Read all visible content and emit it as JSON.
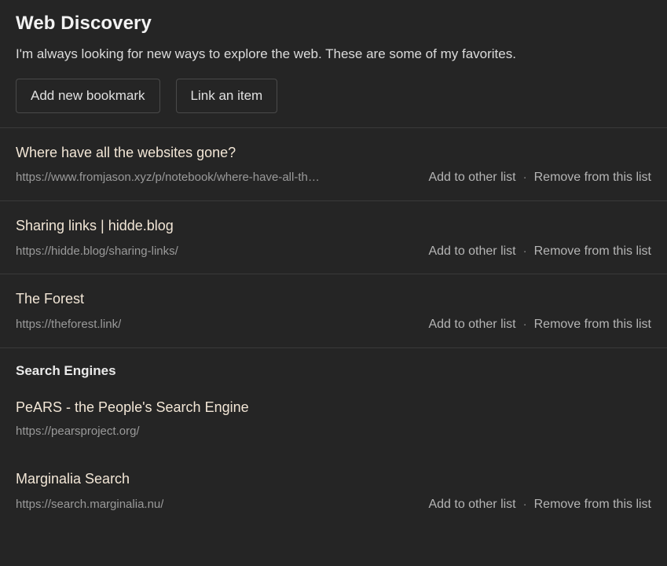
{
  "header": {
    "title": "Web Discovery",
    "description": "I'm always looking for new ways to explore the web. These are some of my favorites.",
    "buttons": {
      "add_bookmark": "Add new bookmark",
      "link_item": "Link an item"
    }
  },
  "actions": {
    "add_to_other_list": "Add to other list",
    "separator": "·",
    "remove_from_this_list": "Remove from this list"
  },
  "bookmarks": [
    {
      "title": "Where have all the websites gone?",
      "url": "https://www.fromjason.xyz/p/notebook/where-have-all-the-websites-gone/",
      "url_display": "https://www.fromjason.xyz/p/notebook/where-have-all-th…",
      "has_actions": true
    },
    {
      "title": "Sharing links | hidde.blog",
      "url": "https://hidde.blog/sharing-links/",
      "url_display": "https://hidde.blog/sharing-links/",
      "has_actions": true
    },
    {
      "title": "The Forest",
      "url": "https://theforest.link/",
      "url_display": "https://theforest.link/",
      "has_actions": true
    }
  ],
  "section": {
    "title": "Search Engines",
    "items": [
      {
        "title": "PeARS - the People's Search Engine",
        "url": "https://pearsproject.org/",
        "url_display": "https://pearsproject.org/",
        "has_actions": false
      },
      {
        "title": "Marginalia Search",
        "url": "https://search.marginalia.nu/",
        "url_display": "https://search.marginalia.nu/",
        "has_actions": true
      }
    ]
  },
  "colors": {
    "background": "#252525",
    "divider": "#3a3a3a",
    "title_text": "#f2f2f2",
    "item_title_text": "#f2e6d6",
    "url_text": "#9a9a9a",
    "action_text": "#b5b5b5",
    "button_border": "#4a4a4a"
  }
}
